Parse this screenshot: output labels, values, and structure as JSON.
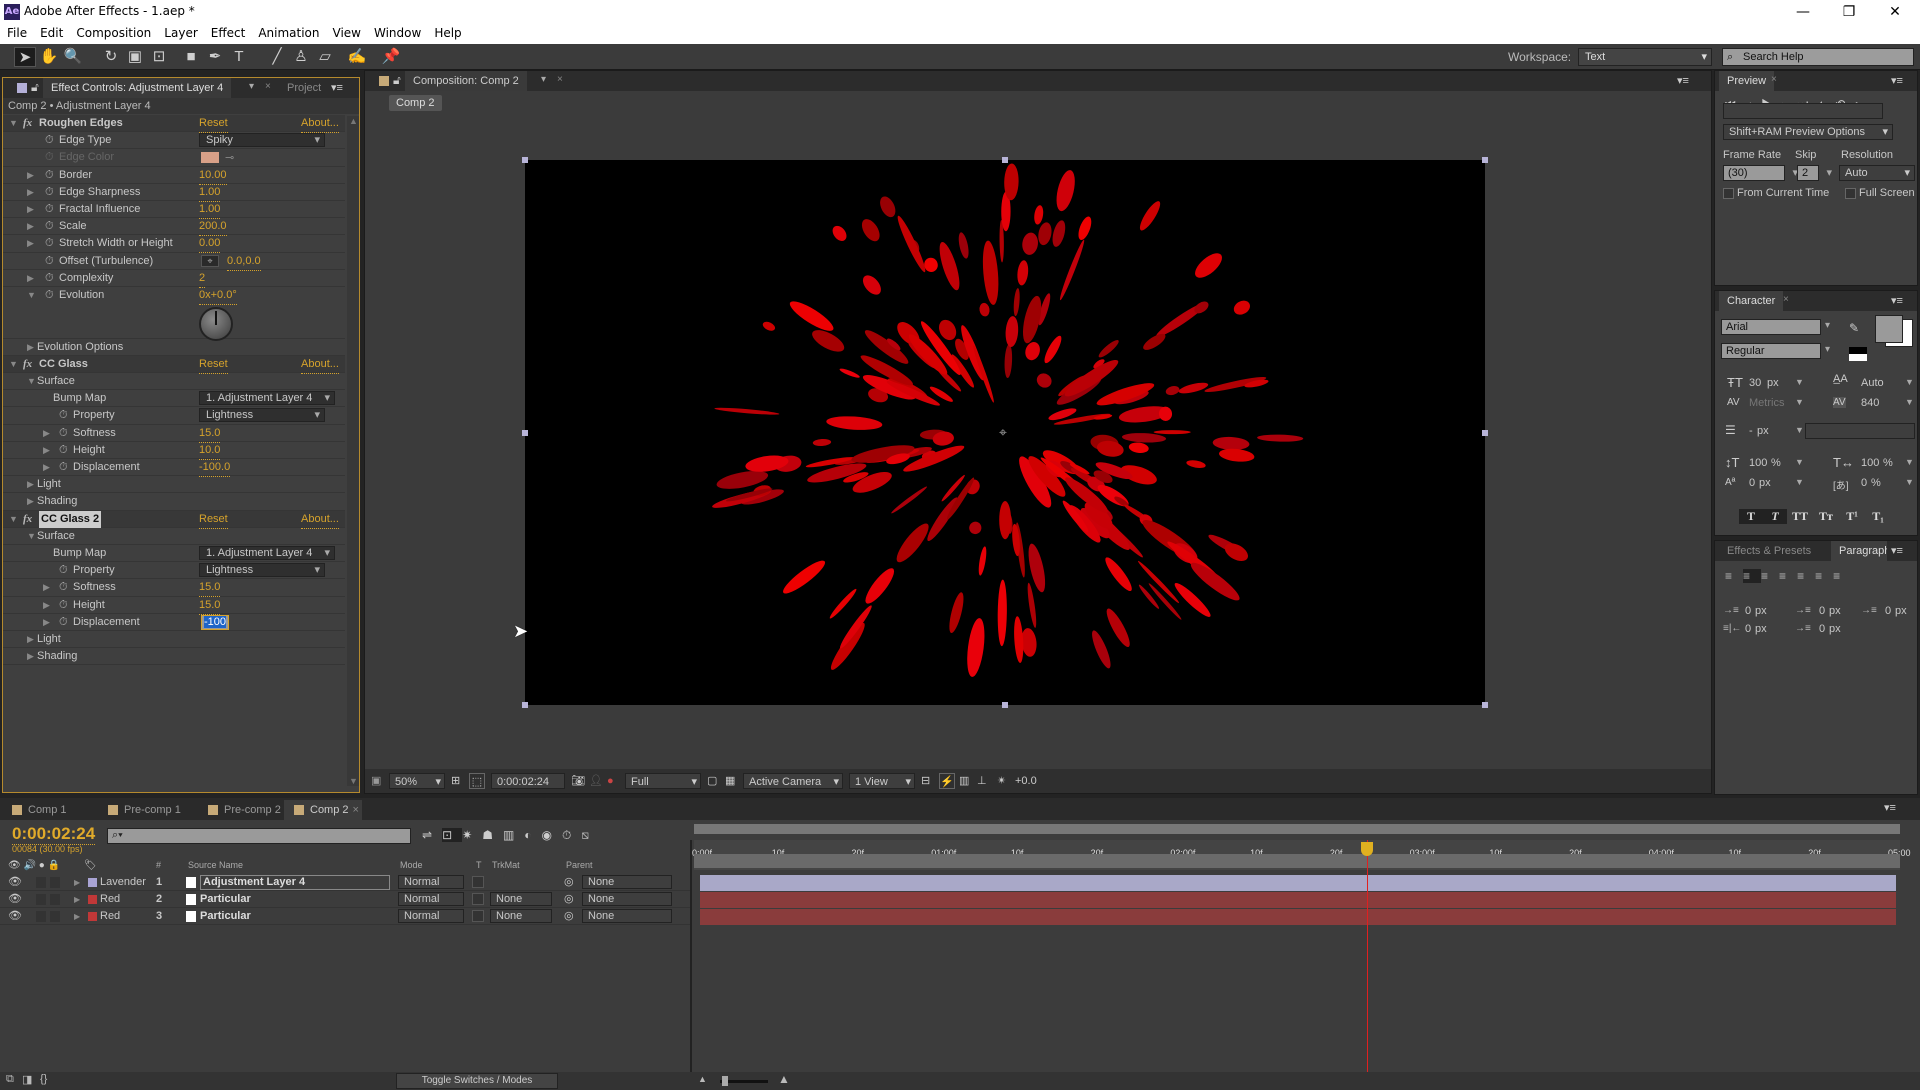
{
  "window": {
    "app_icon": "Ae",
    "title": "Adobe After Effects - 1.aep *",
    "minimize": "—",
    "restore": "❐",
    "close": "✕"
  },
  "menu": [
    "File",
    "Edit",
    "Composition",
    "Layer",
    "Effect",
    "Animation",
    "View",
    "Window",
    "Help"
  ],
  "toolbar": {
    "tools": [
      "selection-tool",
      "hand-tool",
      "zoom-tool",
      "rotate-tool",
      "camera-tool",
      "pan-behind-tool",
      "rectangle-tool",
      "pen-tool",
      "type-tool",
      "brush-tool",
      "clone-stamp-tool",
      "eraser-tool",
      "roto-brush-tool",
      "puppet-pin-tool"
    ],
    "tool_glyphs": [
      "➤",
      "✋",
      "🔍",
      "↻",
      "▣",
      "⊡",
      "■",
      "✒",
      "T",
      "╱",
      "♙",
      "▱",
      "✍",
      "📌"
    ],
    "workspace_label": "Workspace:",
    "workspace_value": "Text",
    "search_placeholder": "Search Help"
  },
  "effect_controls": {
    "tab": "Effect Controls: Adjustment Layer 4",
    "tab2": "Project",
    "subtitle": "Comp 2 • Adjustment Layer 4",
    "reset": "Reset",
    "about": "About...",
    "effects": [
      {
        "name": "Roughen Edges",
        "props": [
          {
            "label": "Edge Type",
            "value": "Spiky",
            "type": "dropdown",
            "indent": 1
          },
          {
            "label": "Edge Color",
            "value": "",
            "type": "color",
            "color": "#d8a088",
            "disabled": true,
            "indent": 1
          },
          {
            "label": "Border",
            "value": "10.00",
            "indent": 1,
            "twirl": true
          },
          {
            "label": "Edge Sharpness",
            "value": "1.00",
            "indent": 1,
            "twirl": true
          },
          {
            "label": "Fractal Influence",
            "value": "1.00",
            "indent": 1,
            "twirl": true
          },
          {
            "label": "Scale",
            "value": "200.0",
            "indent": 1,
            "twirl": true
          },
          {
            "label": "Stretch Width or Height",
            "value": "0.00",
            "indent": 1,
            "twirl": true
          },
          {
            "label": "Offset (Turbulence)",
            "value": "0.0,0.0",
            "type": "point",
            "indent": 1
          },
          {
            "label": "Complexity",
            "value": "2",
            "indent": 1,
            "twirl": true
          },
          {
            "label": "Evolution",
            "value": "0x+0.0°",
            "indent": 1,
            "twirl": true,
            "open": true,
            "dial": true
          },
          {
            "label": "Evolution Options",
            "value": "",
            "indent": 0,
            "twirl": true,
            "group": true
          }
        ]
      },
      {
        "name": "CC Glass",
        "props": [
          {
            "label": "Surface",
            "group": true,
            "open": true,
            "indent": 0
          },
          {
            "label": "Bump Map",
            "value": "1. Adjustment Layer 4",
            "type": "dropdown",
            "indent": 2,
            "nosw": true
          },
          {
            "label": "Property",
            "value": "Lightness",
            "type": "dropdown",
            "indent": 2
          },
          {
            "label": "Softness",
            "value": "15.0",
            "indent": 2,
            "twirl": true
          },
          {
            "label": "Height",
            "value": "10.0",
            "indent": 2,
            "twirl": true
          },
          {
            "label": "Displacement",
            "value": "-100.0",
            "indent": 2,
            "twirl": true
          },
          {
            "label": "Light",
            "group": true,
            "indent": 0
          },
          {
            "label": "Shading",
            "group": true,
            "indent": 0
          }
        ]
      },
      {
        "name": "CC Glass 2",
        "selected": true,
        "props": [
          {
            "label": "Surface",
            "group": true,
            "open": true,
            "indent": 0
          },
          {
            "label": "Bump Map",
            "value": "1. Adjustment Layer 4",
            "type": "dropdown",
            "indent": 2,
            "nosw": true
          },
          {
            "label": "Property",
            "value": "Lightness",
            "type": "dropdown",
            "indent": 2
          },
          {
            "label": "Softness",
            "value": "15.0",
            "indent": 2,
            "twirl": true
          },
          {
            "label": "Height",
            "value": "15.0",
            "indent": 2,
            "twirl": true
          },
          {
            "label": "Displacement",
            "value": "-100",
            "indent": 2,
            "twirl": true,
            "editing": true
          },
          {
            "label": "Light",
            "group": true,
            "indent": 0
          },
          {
            "label": "Shading",
            "group": true,
            "indent": 0
          }
        ]
      }
    ]
  },
  "composition": {
    "tab": "Composition: Comp 2",
    "crumb": "Comp 2",
    "footer": {
      "zoom": "50%",
      "timecode": "0:00:02:24",
      "resolution": "Full",
      "camera": "Active Camera",
      "views": "1 View",
      "exposure": "+0.0"
    }
  },
  "preview": {
    "tab": "Preview",
    "ram_options": "Shift+RAM Preview Options",
    "frame_rate_label": "Frame Rate",
    "frame_rate": "(30)",
    "skip_label": "Skip",
    "skip": "2",
    "resolution_label": "Resolution",
    "resolution": "Auto",
    "from_current": "From Current Time",
    "full_screen": "Full Screen"
  },
  "character": {
    "tab": "Character",
    "font": "Arial",
    "style": "Regular",
    "size": "30",
    "size_unit": "px",
    "leading": "Auto",
    "kerning": "Metrics",
    "tracking": "840",
    "stroke": "-",
    "stroke_unit": "px",
    "vscale": "100",
    "hscale": "100",
    "baseline": "0",
    "baseline_unit": "px",
    "tsume": "0",
    "styles": [
      "T",
      "T",
      "TT",
      "Tт",
      "T¹",
      "T₁"
    ]
  },
  "paragraph": {
    "tab1": "Effects & Presets",
    "tab2": "Paragraph",
    "indent_left": "0",
    "indent_right": "0",
    "indent_first": "0",
    "space_before": "0",
    "space_after": "0",
    "unit": "px"
  },
  "timeline": {
    "tabs": [
      "Comp 1",
      "Pre-comp 1",
      "Pre-comp 2",
      "Comp 2"
    ],
    "active_tab": "Comp 2",
    "time": "0:00:02:24",
    "frame_info": "00084 (30.00 fps)",
    "columns": {
      "num": "#",
      "source": "Source Name",
      "mode": "Mode",
      "t": "T",
      "trkmat": "TrkMat",
      "parent": "Parent"
    },
    "ruler": [
      "0:00f",
      "10f",
      "20f",
      "01:00f",
      "10f",
      "20f",
      "02:00f",
      "10f",
      "20f",
      "03:00f",
      "10f",
      "20f",
      "04:00f",
      "10f",
      "20f",
      "05:00"
    ],
    "playhead_fraction": 0.5627,
    "layers": [
      {
        "label_color_name": "Lavender",
        "color": "#a9a4d4",
        "num": "1",
        "name": "Adjustment Layer 4",
        "mode": "Normal",
        "trkmat": "",
        "parent": "None",
        "bar": "#a9a8c8"
      },
      {
        "label_color_name": "Red",
        "color": "#c03838",
        "num": "2",
        "name": "Particular",
        "mode": "Normal",
        "trkmat": "None",
        "parent": "None",
        "bar": "#8a3c3c"
      },
      {
        "label_color_name": "Red",
        "color": "#c03838",
        "num": "3",
        "name": "Particular",
        "mode": "Normal",
        "trkmat": "None",
        "parent": "None",
        "bar": "#8a3c3c"
      }
    ],
    "toggle_label": "Toggle Switches / Modes"
  }
}
